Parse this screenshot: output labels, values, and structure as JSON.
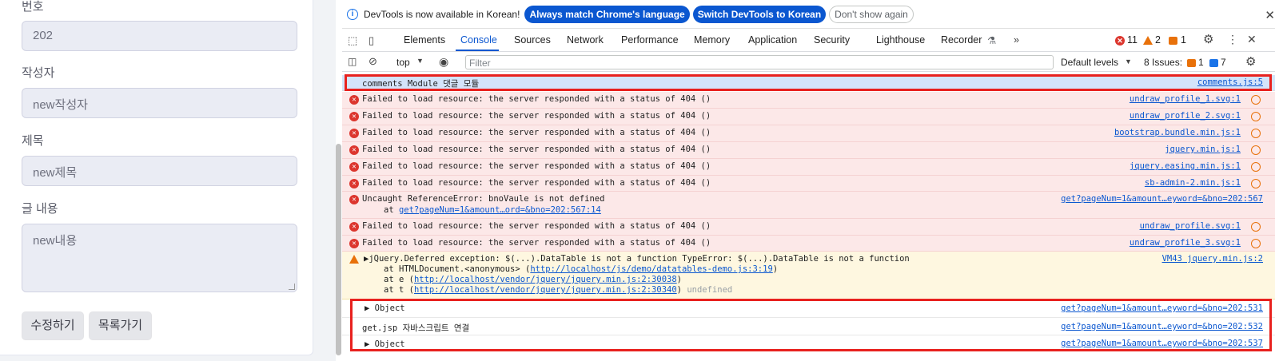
{
  "form": {
    "bno_label": "번호",
    "bno_value": "202",
    "writer_label": "작성자",
    "writer_value": "new작성자",
    "title_label": "제목",
    "title_value": "new제목",
    "content_label": "글 내용",
    "content_value": "new내용",
    "modify_button": "수정하기",
    "list_button": "목록가기"
  },
  "devtools": {
    "infobar": {
      "text": "DevTools is now available in Korean!",
      "btn_match": "Always match Chrome's language",
      "btn_switch": "Switch DevTools to Korean",
      "btn_dismiss": "Don't show again"
    },
    "tabs": [
      "Elements",
      "Console",
      "Sources",
      "Network",
      "Performance",
      "Memory",
      "Application",
      "Security",
      "Lighthouse",
      "Recorder"
    ],
    "active_tab": "Console",
    "more": "»",
    "counts": {
      "errors": "11",
      "warnings": "2",
      "issues": "1"
    },
    "toolbar": {
      "context": "top",
      "filter_placeholder": "Filter",
      "levels": "Default levels",
      "issues_label": "8 Issues:",
      "issues_warn": "1",
      "issues_info": "7"
    },
    "messages": [
      {
        "text": "comments Module 댓글 모듈",
        "src": "comments.js:5"
      },
      {
        "text": "Failed to load resource: the server responded with a status of 404 ()",
        "src": "undraw_profile_1.svg:1"
      },
      {
        "text": "Failed to load resource: the server responded with a status of 404 ()",
        "src": "undraw_profile_2.svg:1"
      },
      {
        "text": "Failed to load resource: the server responded with a status of 404 ()",
        "src": "bootstrap.bundle.min.js:1"
      },
      {
        "text": "Failed to load resource: the server responded with a status of 404 ()",
        "src": "jquery.min.js:1"
      },
      {
        "text": "Failed to load resource: the server responded with a status of 404 ()",
        "src": "jquery.easing.min.js:1"
      },
      {
        "text": "Failed to load resource: the server responded with a status of 404 ()",
        "src": "sb-admin-2.min.js:1"
      },
      {
        "text": "Uncaught ReferenceError: bnoVaule is not defined",
        "src": "get?pageNum=1&amount…eyword=&bno=202:567",
        "sub_prefix": "at ",
        "sub_link": "get?pageNum=1&amount…ord=&bno=202:567:14"
      },
      {
        "text": "Failed to load resource: the server responded with a status of 404 ()",
        "src": "undraw_profile.svg:1"
      },
      {
        "text": "Failed to load resource: the server responded with a status of 404 ()",
        "src": "undraw_profile_3.svg:1"
      },
      {
        "text": "jQuery.Deferred exception: $(...).DataTable is not a function TypeError: $(...).DataTable is not a function",
        "src": "VM43 jquery.min.js:2",
        "l1a": "at HTMLDocument.<anonymous> (",
        "l1b": "http://localhost/js/demo/datatables-demo.js:3:19",
        "l1c": ")",
        "l2a": "at e (",
        "l2b": "http://localhost/vendor/jquery/jquery.min.js:2:30038",
        "l2c": ")",
        "l3a": "at t (",
        "l3b": "http://localhost/vendor/jquery/jquery.min.js:2:30340",
        "l3c": ")",
        "l3d": "undefined"
      },
      {
        "text": "Object",
        "src": "get?pageNum=1&amount…eyword=&bno=202:531"
      },
      {
        "text": "get.jsp 자바스크립트 연결",
        "src": "get?pageNum=1&amount…eyword=&bno=202:532"
      },
      {
        "text": "Object",
        "src": "get?pageNum=1&amount…eyword=&bno=202:537"
      }
    ]
  },
  "colors": {
    "error": "#dc362e",
    "warning": "#e8710a",
    "accent": "#0b57d0",
    "highlight": "#e8211e"
  }
}
